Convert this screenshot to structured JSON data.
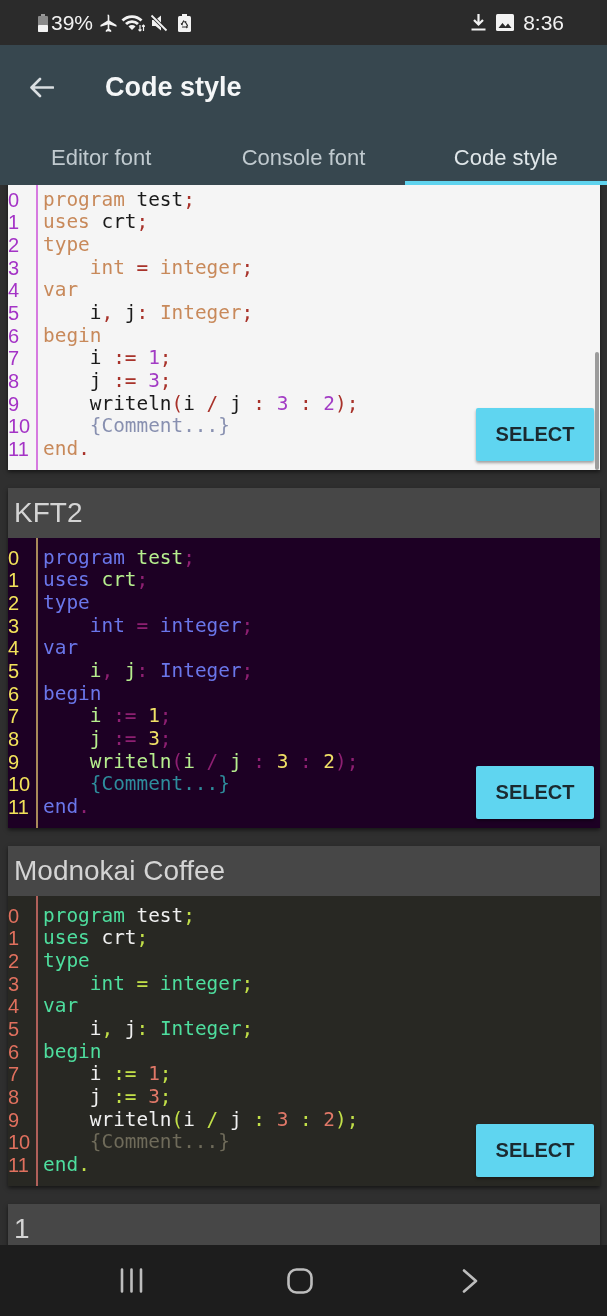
{
  "status_bar": {
    "battery": "39%",
    "time": "8:36"
  },
  "app_bar": {
    "title": "Code style"
  },
  "tabs": [
    {
      "label": "Editor font",
      "selected": false
    },
    {
      "label": "Console font",
      "selected": false
    },
    {
      "label": "Code style",
      "selected": true
    }
  ],
  "styles": [
    {
      "background": {
        "color": "#f5f5f5"
      },
      "line_numbers": {
        "color": "#a433c6"
      },
      "gutter": {
        "color": "#d67ae0"
      },
      "button_label": "SELECT",
      "lines": [
        {
          "number": "0",
          "tokens": [
            {
              "text": "program",
              "color": "#c8895a"
            },
            {
              "text": " test",
              "color": "#1a1a1a"
            },
            {
              "text": ";",
              "color": "#a8322a"
            }
          ]
        },
        {
          "number": "1",
          "tokens": [
            {
              "text": "uses",
              "color": "#c8895a"
            },
            {
              "text": " crt",
              "color": "#1a1a1a"
            },
            {
              "text": ";",
              "color": "#a8322a"
            }
          ]
        },
        {
          "number": "2",
          "tokens": [
            {
              "text": "type",
              "color": "#c8895a"
            }
          ]
        },
        {
          "number": "3",
          "tokens": [
            {
              "text": "    int",
              "color": "#c8895a"
            },
            {
              "text": " =",
              "color": "#a8322a"
            },
            {
              "text": " integer",
              "color": "#c8895a"
            },
            {
              "text": ";",
              "color": "#a8322a"
            }
          ]
        },
        {
          "number": "4",
          "tokens": [
            {
              "text": "var",
              "color": "#c8895a"
            }
          ]
        },
        {
          "number": "5",
          "tokens": [
            {
              "text": "    i",
              "color": "#1a1a1a"
            },
            {
              "text": ",",
              "color": "#a8322a"
            },
            {
              "text": " j",
              "color": "#1a1a1a"
            },
            {
              "text": ":",
              "color": "#a8322a"
            },
            {
              "text": " Integer",
              "color": "#c8895a"
            },
            {
              "text": ";",
              "color": "#a8322a"
            }
          ]
        },
        {
          "number": "6",
          "tokens": [
            {
              "text": "begin",
              "color": "#c8895a"
            }
          ]
        },
        {
          "number": "7",
          "tokens": [
            {
              "text": "    i",
              "color": "#1a1a1a"
            },
            {
              "text": " :=",
              "color": "#a8322a"
            },
            {
              "text": " 1",
              "color": "#a23bc4"
            },
            {
              "text": ";",
              "color": "#a8322a"
            }
          ]
        },
        {
          "number": "8",
          "tokens": [
            {
              "text": "    j",
              "color": "#1a1a1a"
            },
            {
              "text": " :=",
              "color": "#a8322a"
            },
            {
              "text": " 3",
              "color": "#a23bc4"
            },
            {
              "text": ";",
              "color": "#a8322a"
            }
          ]
        },
        {
          "number": "9",
          "tokens": [
            {
              "text": "    writeln",
              "color": "#1a1a1a"
            },
            {
              "text": "(",
              "color": "#a8322a"
            },
            {
              "text": "i",
              "color": "#1a1a1a"
            },
            {
              "text": " /",
              "color": "#a8322a"
            },
            {
              "text": " j",
              "color": "#1a1a1a"
            },
            {
              "text": " :",
              "color": "#a8322a"
            },
            {
              "text": " 3",
              "color": "#a23bc4"
            },
            {
              "text": " :",
              "color": "#a8322a"
            },
            {
              "text": " 2",
              "color": "#a23bc4"
            },
            {
              "text": ")",
              "color": "#a8322a"
            },
            {
              "text": ";",
              "color": "#a8322a"
            }
          ]
        },
        {
          "number": "10",
          "tokens": [
            {
              "text": "    {Comment...}",
              "color": "#8890b0"
            }
          ]
        },
        {
          "number": "11",
          "tokens": [
            {
              "text": "end",
              "color": "#c8895a"
            },
            {
              "text": ".",
              "color": "#a8322a"
            }
          ]
        }
      ]
    },
    {
      "name": "KFT2",
      "background": {
        "color": "#1d0024"
      },
      "line_numbers": {
        "color": "#f2e25a"
      },
      "gutter": {
        "color": "#a88a5a"
      },
      "button_label": "SELECT",
      "lines": [
        {
          "number": "0",
          "tokens": [
            {
              "text": "program",
              "color": "#6a76ea"
            },
            {
              "text": " test",
              "color": "#b6ee8e"
            },
            {
              "text": ";",
              "color": "#8e1f72"
            }
          ]
        },
        {
          "number": "1",
          "tokens": [
            {
              "text": "uses",
              "color": "#6a76ea"
            },
            {
              "text": " crt",
              "color": "#b6ee8e"
            },
            {
              "text": ";",
              "color": "#8e1f72"
            }
          ]
        },
        {
          "number": "2",
          "tokens": [
            {
              "text": "type",
              "color": "#6a76ea"
            }
          ]
        },
        {
          "number": "3",
          "tokens": [
            {
              "text": "    int",
              "color": "#6a76ea"
            },
            {
              "text": " =",
              "color": "#8e1f72"
            },
            {
              "text": " integer",
              "color": "#6a76ea"
            },
            {
              "text": ";",
              "color": "#8e1f72"
            }
          ]
        },
        {
          "number": "4",
          "tokens": [
            {
              "text": "var",
              "color": "#6a76ea"
            }
          ]
        },
        {
          "number": "5",
          "tokens": [
            {
              "text": "    i",
              "color": "#b6ee8e"
            },
            {
              "text": ",",
              "color": "#8e1f72"
            },
            {
              "text": " j",
              "color": "#b6ee8e"
            },
            {
              "text": ":",
              "color": "#8e1f72"
            },
            {
              "text": " Integer",
              "color": "#6a76ea"
            },
            {
              "text": ";",
              "color": "#8e1f72"
            }
          ]
        },
        {
          "number": "6",
          "tokens": [
            {
              "text": "begin",
              "color": "#6a76ea"
            }
          ]
        },
        {
          "number": "7",
          "tokens": [
            {
              "text": "    i",
              "color": "#b6ee8e"
            },
            {
              "text": " :=",
              "color": "#8e1f72"
            },
            {
              "text": " 1",
              "color": "#f0e066"
            },
            {
              "text": ";",
              "color": "#8e1f72"
            }
          ]
        },
        {
          "number": "8",
          "tokens": [
            {
              "text": "    j",
              "color": "#b6ee8e"
            },
            {
              "text": " :=",
              "color": "#8e1f72"
            },
            {
              "text": " 3",
              "color": "#f0e066"
            },
            {
              "text": ";",
              "color": "#8e1f72"
            }
          ]
        },
        {
          "number": "9",
          "tokens": [
            {
              "text": "    writeln",
              "color": "#b6ee8e"
            },
            {
              "text": "(",
              "color": "#8e1f72"
            },
            {
              "text": "i",
              "color": "#b6ee8e"
            },
            {
              "text": " /",
              "color": "#8e1f72"
            },
            {
              "text": " j",
              "color": "#b6ee8e"
            },
            {
              "text": " :",
              "color": "#8e1f72"
            },
            {
              "text": " 3",
              "color": "#f0e066"
            },
            {
              "text": " :",
              "color": "#8e1f72"
            },
            {
              "text": " 2",
              "color": "#f0e066"
            },
            {
              "text": ")",
              "color": "#8e1f72"
            },
            {
              "text": ";",
              "color": "#8e1f72"
            }
          ]
        },
        {
          "number": "10",
          "tokens": [
            {
              "text": "    {Comment...}",
              "color": "#2e8c9c"
            }
          ]
        },
        {
          "number": "11",
          "tokens": [
            {
              "text": "end",
              "color": "#6a76ea"
            },
            {
              "text": ".",
              "color": "#8e1f72"
            }
          ]
        }
      ]
    },
    {
      "name": "Modnokai Coffee",
      "background": {
        "color": "#282823"
      },
      "line_numbers": {
        "color": "#e0705e"
      },
      "gutter": {
        "color": "#b0605a"
      },
      "button_label": "SELECT",
      "lines": [
        {
          "number": "0",
          "tokens": [
            {
              "text": "program",
              "color": "#4ede9e"
            },
            {
              "text": " test",
              "color": "#f0f0f0"
            },
            {
              "text": ";",
              "color": "#c2e048"
            }
          ]
        },
        {
          "number": "1",
          "tokens": [
            {
              "text": "uses",
              "color": "#4ede9e"
            },
            {
              "text": " crt",
              "color": "#f0f0f0"
            },
            {
              "text": ";",
              "color": "#c2e048"
            }
          ]
        },
        {
          "number": "2",
          "tokens": [
            {
              "text": "type",
              "color": "#4ede9e"
            }
          ]
        },
        {
          "number": "3",
          "tokens": [
            {
              "text": "    int",
              "color": "#4ede9e"
            },
            {
              "text": " =",
              "color": "#c2e048"
            },
            {
              "text": " integer",
              "color": "#4ede9e"
            },
            {
              "text": ";",
              "color": "#c2e048"
            }
          ]
        },
        {
          "number": "4",
          "tokens": [
            {
              "text": "var",
              "color": "#4ede9e"
            }
          ]
        },
        {
          "number": "5",
          "tokens": [
            {
              "text": "    i",
              "color": "#f0f0f0"
            },
            {
              "text": ",",
              "color": "#c2e048"
            },
            {
              "text": " j",
              "color": "#f0f0f0"
            },
            {
              "text": ":",
              "color": "#c2e048"
            },
            {
              "text": " Integer",
              "color": "#4ede9e"
            },
            {
              "text": ";",
              "color": "#c2e048"
            }
          ]
        },
        {
          "number": "6",
          "tokens": [
            {
              "text": "begin",
              "color": "#4ede9e"
            }
          ]
        },
        {
          "number": "7",
          "tokens": [
            {
              "text": "    i",
              "color": "#f0f0f0"
            },
            {
              "text": " :=",
              "color": "#c2e048"
            },
            {
              "text": " 1",
              "color": "#e07868"
            },
            {
              "text": ";",
              "color": "#c2e048"
            }
          ]
        },
        {
          "number": "8",
          "tokens": [
            {
              "text": "    j",
              "color": "#f0f0f0"
            },
            {
              "text": " :=",
              "color": "#c2e048"
            },
            {
              "text": " 3",
              "color": "#e07868"
            },
            {
              "text": ";",
              "color": "#c2e048"
            }
          ]
        },
        {
          "number": "9",
          "tokens": [
            {
              "text": "    writeln",
              "color": "#f0f0f0"
            },
            {
              "text": "(",
              "color": "#c2e048"
            },
            {
              "text": "i",
              "color": "#f0f0f0"
            },
            {
              "text": " /",
              "color": "#c2e048"
            },
            {
              "text": " j",
              "color": "#f0f0f0"
            },
            {
              "text": " :",
              "color": "#c2e048"
            },
            {
              "text": " 3",
              "color": "#e07868"
            },
            {
              "text": " :",
              "color": "#c2e048"
            },
            {
              "text": " 2",
              "color": "#e07868"
            },
            {
              "text": ")",
              "color": "#c2e048"
            },
            {
              "text": ";",
              "color": "#c2e048"
            }
          ]
        },
        {
          "number": "10",
          "tokens": [
            {
              "text": "    {Comment...}",
              "color": "#6f6b5a"
            }
          ]
        },
        {
          "number": "11",
          "tokens": [
            {
              "text": "end",
              "color": "#4ede9e"
            },
            {
              "text": ".",
              "color": "#c2e048"
            }
          ]
        }
      ]
    },
    {
      "name": "1"
    }
  ]
}
